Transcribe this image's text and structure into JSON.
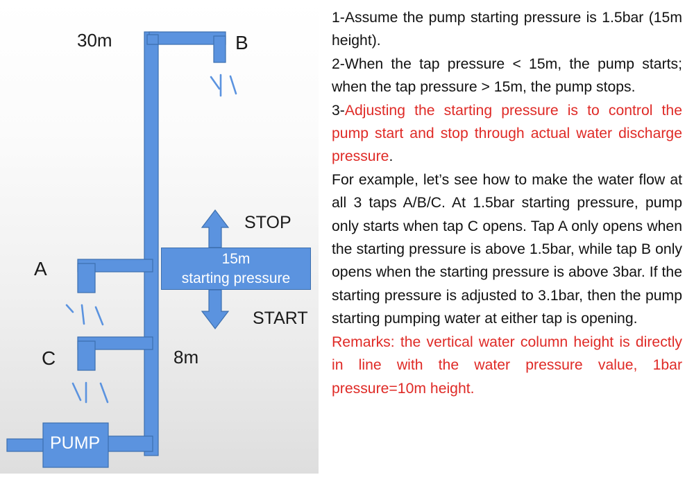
{
  "diagram": {
    "labels": {
      "height_30m": "30m",
      "tap_b": "B",
      "tap_a": "A",
      "tap_c": "C",
      "height_8m": "8m",
      "stop": "STOP",
      "start": "START",
      "pump": "PUMP"
    },
    "pressure_band": {
      "line1": "15m",
      "line2": "starting pressure"
    },
    "colors": {
      "pipe_blue": "#5B93DF",
      "pipe_stroke": "#3C6FAE",
      "spray_blue": "#5B93DF",
      "label_black": "#1A1A1A",
      "panel_top": "#FFFFFF",
      "panel_bottom": "#DEDEDE"
    }
  },
  "notes": {
    "colors": {
      "body": "#111111",
      "highlight": "#DF2A26"
    },
    "item1": "1-Assume the pump starting pressure is 1.5bar (15m height).",
    "item2": "2-When the tap pressure < 15m, the pump starts; when the tap pressure > 15m, the pump stops.",
    "item3_prefix": "3-",
    "item3_red": "Adjusting the starting pressure is to control the pump start and stop through actual water discharge pressure",
    "item3_suffix": ".",
    "item4": "For example, let’s see how to make the water flow at all 3 taps A/B/C. At 1.5bar starting pressure, pump only starts when tap C opens. Tap A only opens when the starting pressure is above 1.5bar, while tap B only opens when the starting pressure is above 3bar. If the starting pressure is adjusted to 3.1bar, then the pump starting pumping water at either tap is opening.",
    "remarks": "Remarks: the vertical water column height is directly in line with the water pressure value, 1bar pressure=10m height."
  }
}
